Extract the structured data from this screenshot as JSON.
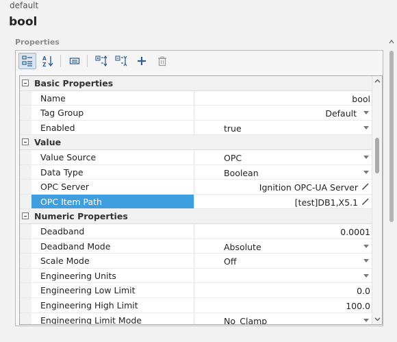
{
  "header": {
    "breadcrumb": "default",
    "title": "bool",
    "section": "Properties"
  },
  "toolbar": {
    "buttons": [
      {
        "name": "categorized-view-button",
        "icon": "categorized-icon",
        "active": true
      },
      {
        "name": "sort-alpha-button",
        "icon": "sort-az-icon",
        "active": false
      },
      {
        "name": "description-button",
        "icon": "description-icon",
        "active": false
      },
      {
        "name": "expand-all-button",
        "icon": "expand-icon",
        "active": false
      },
      {
        "name": "collapse-all-button",
        "icon": "collapse-icon",
        "active": false
      },
      {
        "name": "add-button",
        "icon": "plus-icon",
        "active": false
      },
      {
        "name": "delete-button",
        "icon": "trash-icon",
        "active": false
      }
    ]
  },
  "properties": {
    "basic": {
      "label": "Basic Properties",
      "name": {
        "label": "Name",
        "value": "bool"
      },
      "tag_group": {
        "label": "Tag Group",
        "value": "Default"
      },
      "enabled": {
        "label": "Enabled",
        "value": "true"
      }
    },
    "value": {
      "label": "Value",
      "value_source": {
        "label": "Value Source",
        "value": "OPC"
      },
      "data_type": {
        "label": "Data Type",
        "value": "Boolean"
      },
      "opc_server": {
        "label": "OPC Server",
        "value": "Ignition OPC-UA Server"
      },
      "opc_item_path": {
        "label": "OPC Item Path",
        "value": "[test]DB1,X5.1"
      }
    },
    "numeric": {
      "label": "Numeric Properties",
      "deadband": {
        "label": "Deadband",
        "value": "0.0001"
      },
      "deadband_mode": {
        "label": "Deadband Mode",
        "value": "Absolute"
      },
      "scale_mode": {
        "label": "Scale Mode",
        "value": "Off"
      },
      "eng_units": {
        "label": "Engineering Units",
        "value": ""
      },
      "eng_low": {
        "label": "Engineering Low Limit",
        "value": "0.0"
      },
      "eng_high": {
        "label": "Engineering High Limit",
        "value": "100.0"
      },
      "eng_limit_mode": {
        "label": "Engineering Limit Mode",
        "value": "No_Clamp"
      }
    }
  },
  "colors": {
    "selection": "#3d9ee0",
    "toolbar_icon": "#2f5f8f"
  }
}
